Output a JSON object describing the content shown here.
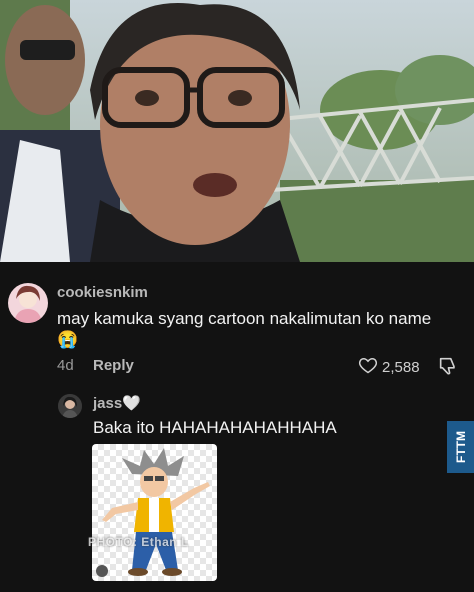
{
  "comment": {
    "username": "cookiesnkim",
    "text": "may kamuka syang cartoon nakalimutan ko name",
    "emoji": "😭",
    "age": "4d",
    "reply_label": "Reply",
    "likes": "2,588",
    "avatar_icon": "profile-avatar-icon"
  },
  "reply": {
    "username": "jass🤍",
    "text": "Baka ito HAHAHAHAHAHHAHA",
    "sticker_icon": "cartoon-character-sticker",
    "watermark": "PHOTO: Ethan L"
  },
  "badge": {
    "label": "FTTM",
    "color": "#1d5a8c"
  },
  "colors": {
    "background": "#121212",
    "text": "#f2f2f2",
    "muted": "#9a9a9a"
  }
}
